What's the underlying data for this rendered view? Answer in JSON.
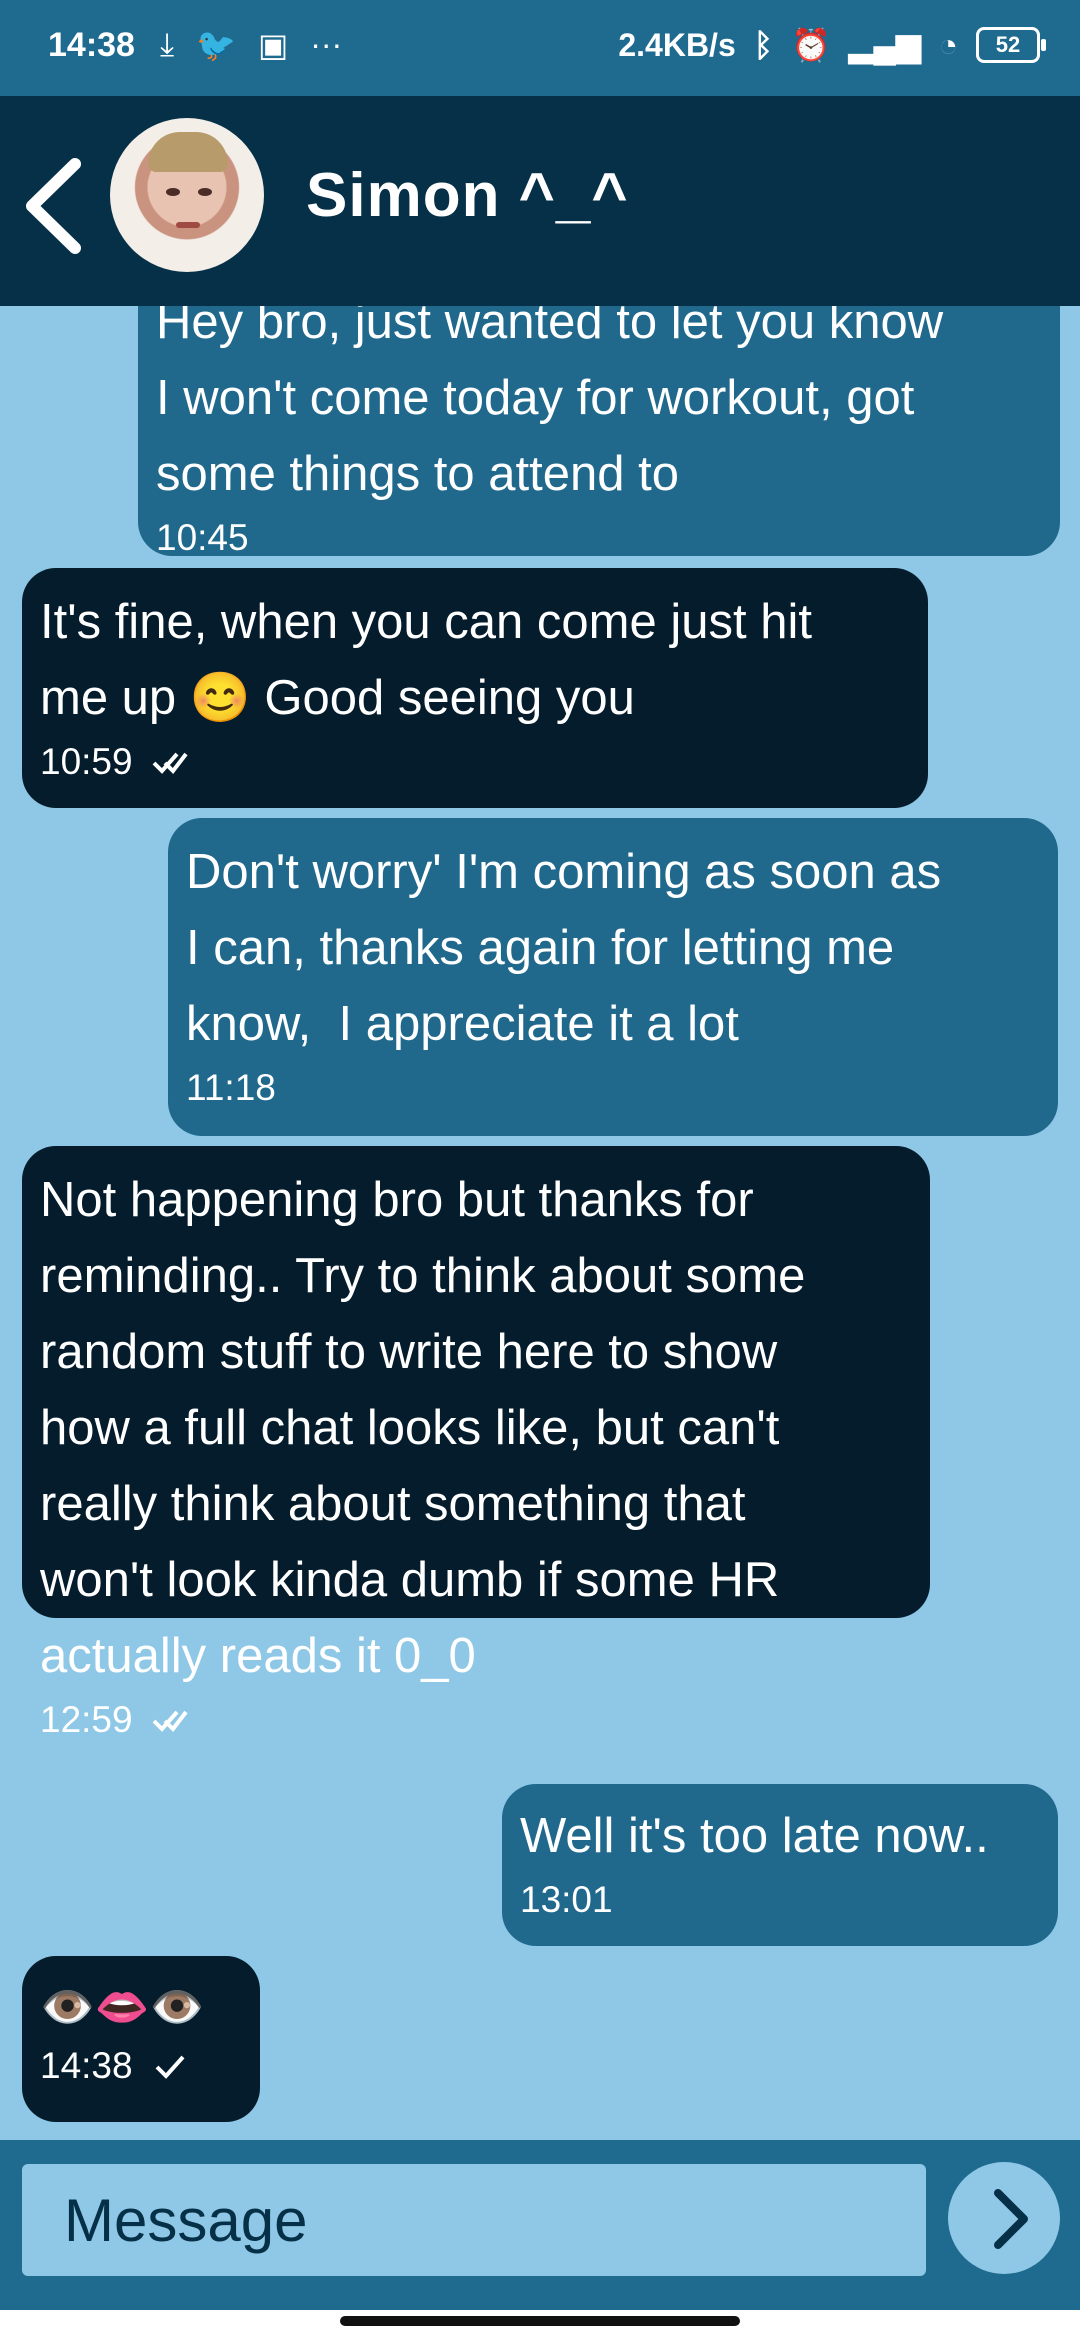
{
  "status_bar": {
    "time": "14:38",
    "network_speed": "2.4KB/s",
    "battery": "52",
    "left_icons": [
      "download-icon",
      "twitter-icon",
      "app-icon",
      "more-icon"
    ],
    "right_icons": [
      "bluetooth-icon",
      "alarm-icon",
      "signal-icon",
      "wifi-icon",
      "battery-icon"
    ]
  },
  "header": {
    "contact_name": "Simon ^_^",
    "back_icon": "chevron-left-icon"
  },
  "messages": [
    {
      "text": "Hey bro, just wanted to let you know\nI won't come today for workout, got\nsome things to attend to",
      "time": "10:45",
      "direction": "outgoing"
    },
    {
      "text": "It's fine, when you can come just hit\nme up 😊 Good seeing you",
      "time": "10:59",
      "direction": "incoming",
      "status": "double-check-icon"
    },
    {
      "text": "Don't worry' I'm coming as soon as\nI can, thanks again for letting me\nknow,  I appreciate it a lot",
      "time": "11:18",
      "direction": "outgoing"
    },
    {
      "text": "Not happening bro but thanks for\nreminding.. Try to think about some\nrandom stuff to write here to show\nhow a full chat looks like, but can't\nreally think about something that\nwon't look kinda dumb if some HR\nactually reads it 0_0",
      "time": "12:59",
      "direction": "incoming",
      "status": "double-check-icon"
    },
    {
      "text": "Well it's too late now..",
      "time": "13:01",
      "direction": "outgoing"
    },
    {
      "text": "👁️👄👁️",
      "time": "14:38",
      "direction": "incoming",
      "status": "check-icon"
    }
  ],
  "composer": {
    "placeholder": "Message",
    "send_icon": "chevron-right-icon"
  },
  "colors": {
    "background": "#8ec8e6",
    "header": "#063047",
    "outgoing_bubble": "#20698d",
    "incoming_bubble": "#051c2c",
    "status_bar": "#1f6a8f"
  }
}
